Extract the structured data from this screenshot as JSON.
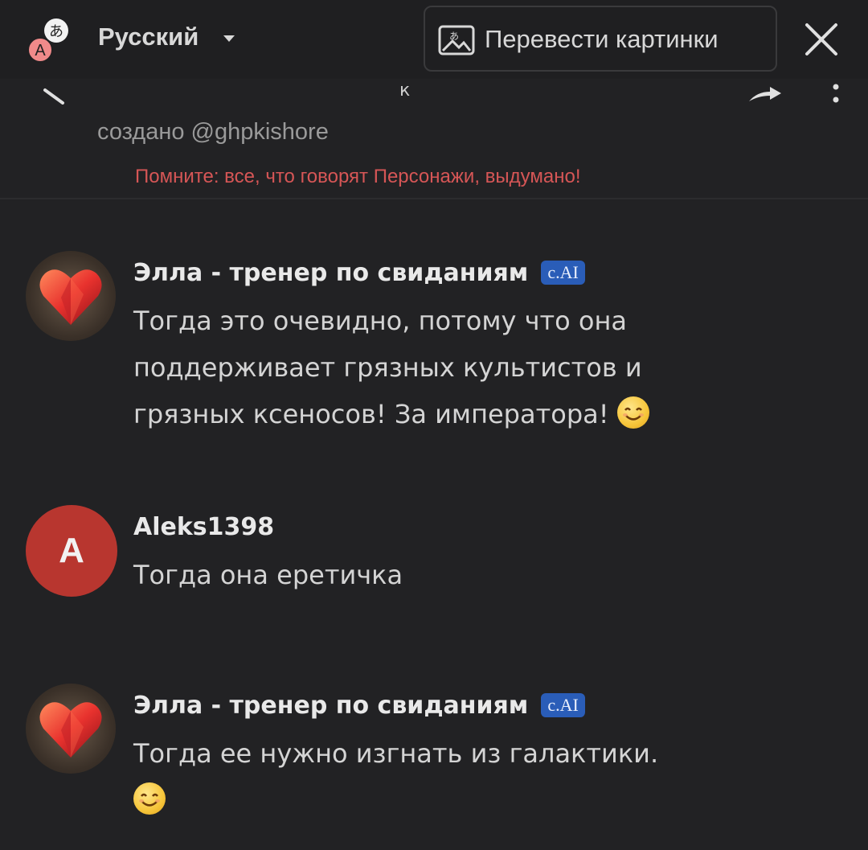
{
  "translate_bar": {
    "language": "Русский",
    "translate_images_label": "Перевести картинки"
  },
  "chat_header": {
    "title_fragment": "к",
    "creator": "создано @ghpkishore",
    "warning": "Помните: все, что говорят Персонажи, выдумано!"
  },
  "messages": [
    {
      "author": "Элла - тренер по свиданиям",
      "badge": "c.AI",
      "text_lines": [
        "Тогда это очевидно, потому что она",
        "поддерживает грязных культистов и",
        "грязных ксеносов! За императора!"
      ],
      "emoji": "smiling-face"
    },
    {
      "author": "Aleks1398",
      "avatar_letter": "A",
      "text_lines": [
        "Тогда она еретичка"
      ]
    },
    {
      "author": "Элла - тренер по свиданиям",
      "badge": "c.AI",
      "text_lines": [
        "Тогда ее нужно изгнать из галактики."
      ],
      "emoji": "smiling-face"
    }
  ],
  "colors": {
    "background": "#222224",
    "warning": "#d65656",
    "badge": "#2a5db8",
    "user_avatar": "#b8362f"
  }
}
